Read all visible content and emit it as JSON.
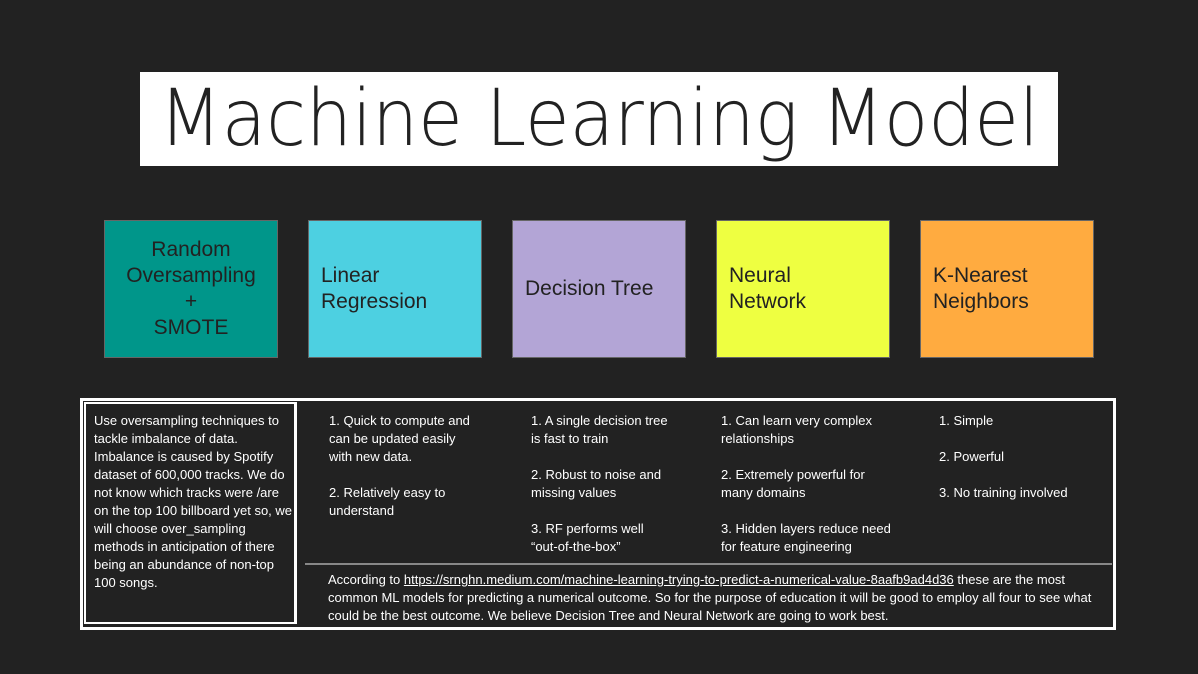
{
  "title": "Machine Learning Model",
  "cards": [
    {
      "label": "Random\nOversampling\n+\nSMOTE",
      "color": "#00968a"
    },
    {
      "label": "Linear\nRegression",
      "color": "#4dd0e1"
    },
    {
      "label": "Decision Tree",
      "color": "#b3a5d6"
    },
    {
      "label": "Neural\nNetwork",
      "color": "#eeff41"
    },
    {
      "label": "K-Nearest\nNeighbors",
      "color": "#ffab40"
    }
  ],
  "left_text": "Use oversampling techniques to tackle imbalance of data. Imbalance is caused by Spotify dataset of 600,000 tracks. We do not know which tracks were /are on the top 100 billboard yet so, we will choose over_sampling methods in anticipation of there being an abundance of non-top 100 songs.",
  "columns": [
    "1. Quick to compute and\ncan be updated easily\nwith new data.\n\n2. Relatively easy to\nunderstand",
    "1. A single decision tree\nis fast to train\n\n2. Robust to noise and\nmissing values\n\n3. RF performs well\n“out-of-the-box”",
    "1. Can learn very complex\nrelationships\n\n2. Extremely powerful for\nmany domains\n\n3. Hidden layers reduce need\nfor feature engineering",
    "1. Simple\n\n2. Powerful\n\n3. No training involved"
  ],
  "footer": {
    "prefix": "According to ",
    "link": "https://srnghn.medium.com/machine-learning-trying-to-predict-a-numerical-value-8aafb9ad4d36",
    "suffix": " these are the most common ML models for predicting a numerical outcome. So for the purpose of education it will be good to employ all four to see what could be the best outcome. We believe Decision Tree and Neural Network are going to work best."
  }
}
